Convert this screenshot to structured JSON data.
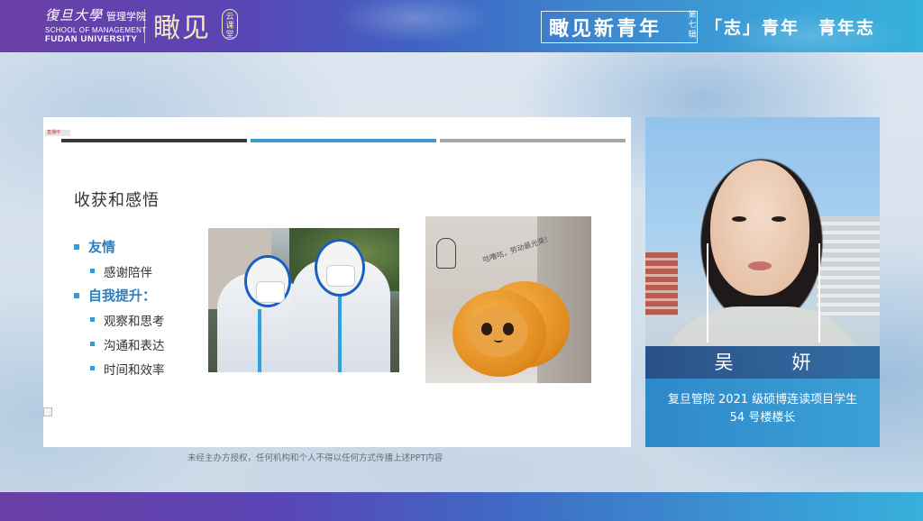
{
  "header": {
    "university_cn": "復旦大學",
    "school_cn": "管理学院",
    "school_en_line1": "SCHOOL OF MANAGEMENT",
    "school_en_line2": "FUDAN UNIVERSITY",
    "series_name": "瞰见",
    "series_badge": "云课堂",
    "program_title": "瞰见新青年",
    "episode": "第七辑",
    "theme": "「志」青年　青年志"
  },
  "slide": {
    "title": "收获和感悟",
    "tag": "直播中",
    "bullets": [
      {
        "level": 1,
        "text": "友情"
      },
      {
        "level": 2,
        "text": "感谢陪伴"
      },
      {
        "level": 1,
        "text": "自我提升："
      },
      {
        "level": 2,
        "text": "观察和思考"
      },
      {
        "level": 2,
        "text": "沟通和表达"
      },
      {
        "level": 2,
        "text": "时间和效率"
      }
    ],
    "photo2_doodle": "咕噜咕，劳动最光荣！"
  },
  "disclaimer": "未经主办方授权，任何机构和个人不得以任何方式传播上述PPT内容",
  "speaker": {
    "name": "吴　妍",
    "caption_line1": "复旦管院 2021 级硕博连读项目学生",
    "caption_line2": "54 号楼楼长"
  },
  "colors": {
    "accent_blue": "#3d9ad0",
    "banner_purple": "#6b3fa6",
    "banner_cyan": "#36b0dc"
  }
}
